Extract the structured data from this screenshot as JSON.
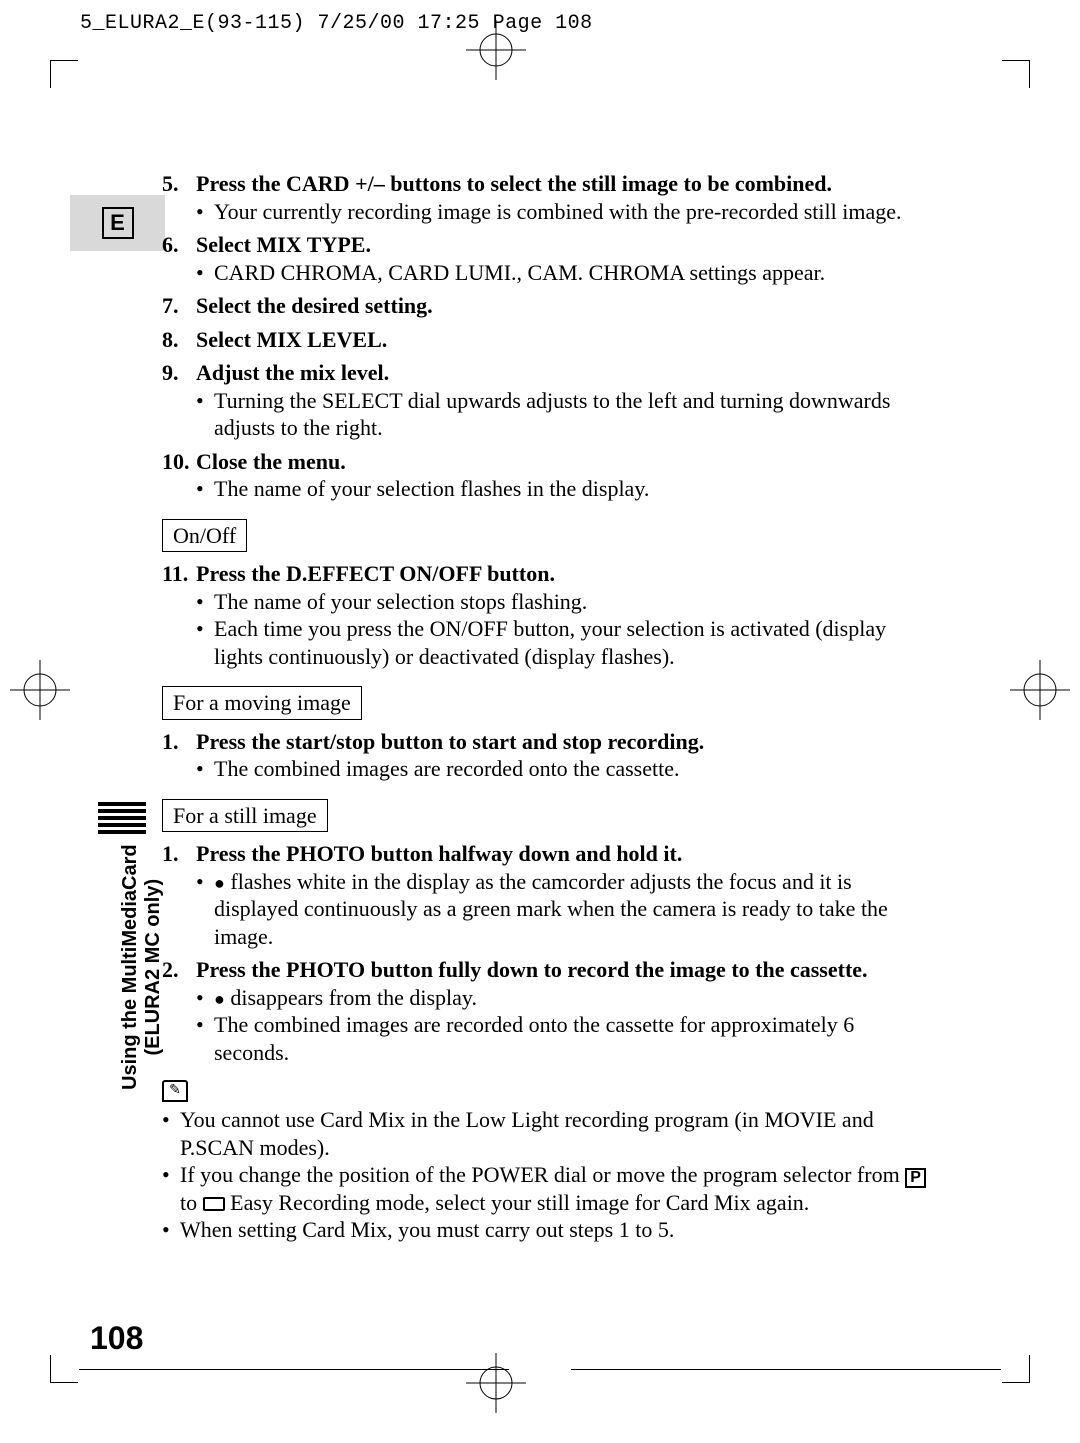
{
  "header": "5_ELURA2_E(93-115)  7/25/00 17:25  Page 108",
  "eboxLetter": "E",
  "sidebarLine1": "Using the MultiMediaCard",
  "sidebarLine2": "(ELURA2 MC only)",
  "pageNumber": "108",
  "step5": {
    "num": "5.",
    "title": "Press the CARD +/– buttons to select the still image to be combined.",
    "bullets": [
      "Your currently recording image is combined with the pre-recorded still image."
    ]
  },
  "step6": {
    "num": "6.",
    "title": "Select MIX TYPE.",
    "bullets": [
      "CARD CHROMA, CARD LUMI., CAM. CHROMA settings appear."
    ]
  },
  "step7": {
    "num": "7.",
    "title": "Select the desired setting."
  },
  "step8": {
    "num": "8.",
    "title": "Select MIX LEVEL."
  },
  "step9": {
    "num": "9.",
    "title": "Adjust the mix level.",
    "bullets": [
      "Turning the SELECT dial upwards adjusts to the left and turning downwards adjusts to the right."
    ]
  },
  "step10": {
    "num": "10.",
    "title": "Close the menu.",
    "bullets": [
      "The name of your selection flashes in the display."
    ]
  },
  "boxOnOff": "On/Off",
  "step11": {
    "num": "11.",
    "title": "Press the D.EFFECT ON/OFF button.",
    "bullets": [
      "The name of your selection stops flashing.",
      "Each time you press the ON/OFF button, your selection is activated (display lights continuously) or deactivated (display flashes)."
    ]
  },
  "boxMoving": "For a moving image",
  "moving1": {
    "num": "1.",
    "title": "Press the start/stop button to start and stop recording.",
    "bullets": [
      "The combined images are recorded onto the cassette."
    ]
  },
  "boxStill": "For a still image",
  "still1": {
    "num": "1.",
    "title": "Press the PHOTO button halfway down and hold it.",
    "bullet1a": " flashes white in the display as the camcorder adjusts the focus and it is displayed continuously as a green mark when the camera is ready to take the image."
  },
  "still2": {
    "num": "2.",
    "title": "Press the PHOTO button fully down to record the image to the cassette.",
    "bullet2a": " disappears from the display.",
    "bullet2b": "The combined images are recorded onto the cassette for approximately 6 seconds."
  },
  "note1": "You cannot use Card Mix in the Low Light recording program (in MOVIE and P.SCAN modes).",
  "note2a": "If you change the position of the POWER dial or move the program selector from ",
  "note2b": " to ",
  "note2c": " Easy Recording mode, select your still image for Card Mix again.",
  "note3": "When setting Card Mix, you must carry out steps 1 to 5.",
  "pLetter": "P"
}
